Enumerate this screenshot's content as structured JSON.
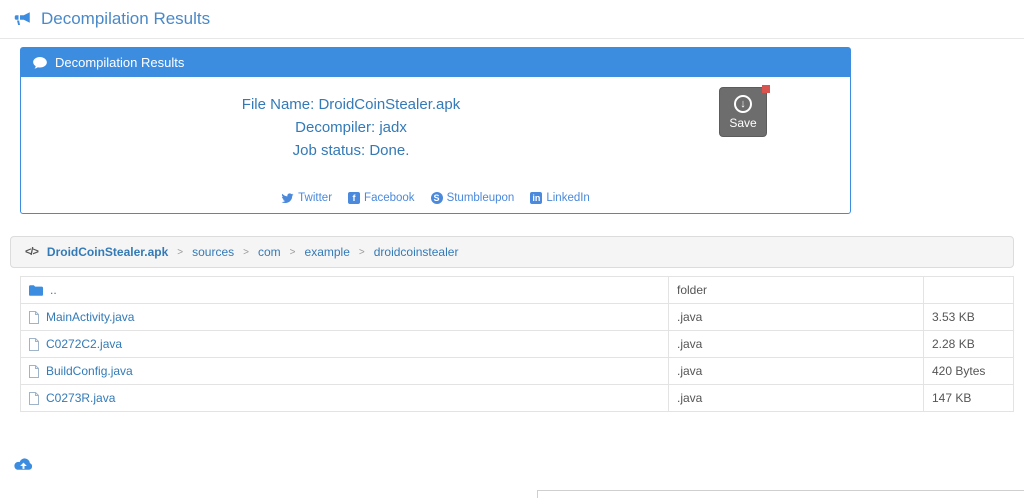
{
  "page": {
    "title": "Decompilation Results"
  },
  "panel": {
    "header_title": "Decompilation Results",
    "file_name_line": "File Name: DroidCoinStealer.apk",
    "decompiler_line": "Decompiler: jadx",
    "job_status_line": "Job status: Done.",
    "save_label": "Save",
    "save_icon_glyph": "↓",
    "share_links": [
      {
        "label": "Twitter"
      },
      {
        "label": "Facebook",
        "badge": "f"
      },
      {
        "label": "Stumbleupon",
        "badge": "S"
      },
      {
        "label": "LinkedIn",
        "badge": "in"
      }
    ]
  },
  "breadcrumb": {
    "code_icon": "</>",
    "separator": ">",
    "items": [
      "DroidCoinStealer.apk",
      "sources",
      "com",
      "example",
      "droidcoinstealer"
    ]
  },
  "file_table": {
    "rows": [
      {
        "name": "..",
        "type": "folder",
        "size": ""
      },
      {
        "name": "MainActivity.java",
        "type": ".java",
        "size": "3.53 KB"
      },
      {
        "name": "C0272C2.java",
        "type": ".java",
        "size": "2.28 KB"
      },
      {
        "name": "BuildConfig.java",
        "type": ".java",
        "size": "420 Bytes"
      },
      {
        "name": "C0273R.java",
        "type": ".java",
        "size": "147 KB"
      }
    ]
  },
  "colors": {
    "accent_blue": "#3c8de0",
    "link_blue": "#337ab7",
    "share_blue": "#4a89dc",
    "badge_red": "#d9534f"
  }
}
